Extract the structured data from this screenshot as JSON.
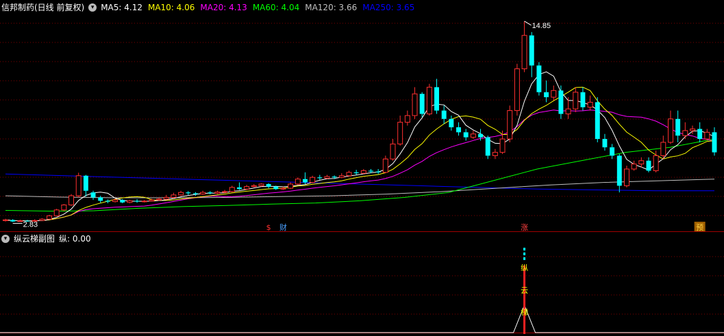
{
  "main_header": {
    "title": "信邦制药(日线 前复权)",
    "ma": [
      {
        "label": "MA5: 4.12",
        "color": "#ffffff"
      },
      {
        "label": "MA10: 4.06",
        "color": "#ffff00"
      },
      {
        "label": "MA20: 4.13",
        "color": "#ff00ff"
      },
      {
        "label": "MA60: 4.04",
        "color": "#00ff00"
      },
      {
        "label": "MA120: 3.66",
        "color": "#c0c0c0"
      },
      {
        "label": "MA250: 3.65",
        "color": "#0000ff"
      }
    ]
  },
  "sub_header": {
    "title": "纵云梯副图",
    "value_label": "纵: 0.00"
  },
  "annotations": {
    "low": "2.83",
    "high": "14.85",
    "markers": [
      {
        "text": "$",
        "color": "#ff3030"
      },
      {
        "text": "财",
        "color": "#4aa0ff"
      },
      {
        "text": "涨",
        "color": "#ff4040"
      },
      {
        "text": "预",
        "color": "#ffd040"
      }
    ],
    "sub_chars": [
      "纵",
      "云",
      "梯"
    ]
  },
  "colors": {
    "up": "#ff3030",
    "down": "#00ffff",
    "grid": "#800000",
    "ma5": "#ffffff",
    "ma10": "#ffff00",
    "ma20": "#ff00ff",
    "ma60": "#00ff00",
    "ma120": "#c0c0c0",
    "ma250": "#0000ff"
  },
  "chart_data": {
    "type": "candlestick",
    "y_range_approx": [
      2.6,
      15.3
    ],
    "candles": [
      [
        2.91,
        2.96,
        3.02,
        2.86
      ],
      [
        2.95,
        2.86,
        3.0,
        2.83
      ],
      [
        2.86,
        2.9,
        2.97,
        2.85
      ],
      [
        2.9,
        2.88,
        2.96,
        2.85
      ],
      [
        2.88,
        2.92,
        2.99,
        2.86
      ],
      [
        2.92,
        3.0,
        3.06,
        2.9
      ],
      [
        3.0,
        3.2,
        3.26,
        2.98
      ],
      [
        3.2,
        3.55,
        3.62,
        3.18
      ],
      [
        3.55,
        3.85,
        3.9,
        3.5
      ],
      [
        3.85,
        4.4,
        4.5,
        3.8
      ],
      [
        4.4,
        5.6,
        5.78,
        4.3
      ],
      [
        5.6,
        4.7,
        5.65,
        4.35
      ],
      [
        4.6,
        4.3,
        4.7,
        4.15
      ],
      [
        4.3,
        4.1,
        4.4,
        3.98
      ],
      [
        4.1,
        4.05,
        4.18,
        3.95
      ],
      [
        4.05,
        4.15,
        4.23,
        4.0
      ],
      [
        4.15,
        4.0,
        4.2,
        3.95
      ],
      [
        4.0,
        4.1,
        4.16,
        3.95
      ],
      [
        4.1,
        4.05,
        4.2,
        3.98
      ],
      [
        4.05,
        4.08,
        4.15,
        4.0
      ],
      [
        4.08,
        4.15,
        4.22,
        4.05
      ],
      [
        4.15,
        4.2,
        4.28,
        4.1
      ],
      [
        4.2,
        4.3,
        4.45,
        4.15
      ],
      [
        4.3,
        4.45,
        4.58,
        4.25
      ],
      [
        4.45,
        4.6,
        4.7,
        4.4
      ],
      [
        4.6,
        4.55,
        4.68,
        4.45
      ],
      [
        4.55,
        4.5,
        4.62,
        4.4
      ],
      [
        4.5,
        4.6,
        4.7,
        4.45
      ],
      [
        4.6,
        4.55,
        4.68,
        4.48
      ],
      [
        4.55,
        4.62,
        4.7,
        4.5
      ],
      [
        4.62,
        4.65,
        4.75,
        4.55
      ],
      [
        4.65,
        4.9,
        5.0,
        4.6
      ],
      [
        4.9,
        4.8,
        5.2,
        4.75
      ],
      [
        4.8,
        4.95,
        5.05,
        4.75
      ],
      [
        4.95,
        5.0,
        5.1,
        4.9
      ],
      [
        5.0,
        5.1,
        5.15,
        4.95
      ],
      [
        5.1,
        4.95,
        5.15,
        4.85
      ],
      [
        4.95,
        4.8,
        5.0,
        4.75
      ],
      [
        4.8,
        4.85,
        4.95,
        4.75
      ],
      [
        4.85,
        5.1,
        5.2,
        4.8
      ],
      [
        5.1,
        5.4,
        5.5,
        5.05
      ],
      [
        5.4,
        5.2,
        5.8,
        5.1
      ],
      [
        5.2,
        5.5,
        5.6,
        5.15
      ],
      [
        5.5,
        5.45,
        5.65,
        5.35
      ],
      [
        5.45,
        5.55,
        5.65,
        5.4
      ],
      [
        5.55,
        5.5,
        5.62,
        5.4
      ],
      [
        5.5,
        5.6,
        5.75,
        5.45
      ],
      [
        5.6,
        5.8,
        5.9,
        5.55
      ],
      [
        5.8,
        5.75,
        5.95,
        5.65
      ],
      [
        5.75,
        5.9,
        6.0,
        5.7
      ],
      [
        5.9,
        5.85,
        6.0,
        5.75
      ],
      [
        5.85,
        5.8,
        6.0,
        5.7
      ],
      [
        5.8,
        6.6,
        6.8,
        5.75
      ],
      [
        6.6,
        7.5,
        7.8,
        6.5
      ],
      [
        7.5,
        8.8,
        9.2,
        7.4
      ],
      [
        8.8,
        9.2,
        9.5,
        8.6
      ],
      [
        9.2,
        10.5,
        10.9,
        9.0
      ],
      [
        10.5,
        9.3,
        10.6,
        9.1
      ],
      [
        9.3,
        10.9,
        11.1,
        9.2
      ],
      [
        10.9,
        9.5,
        11.4,
        9.3
      ],
      [
        9.5,
        9.0,
        9.8,
        8.7
      ],
      [
        9.0,
        8.5,
        9.2,
        8.3
      ],
      [
        8.5,
        8.2,
        8.8,
        8.0
      ],
      [
        8.2,
        7.9,
        8.4,
        7.7
      ],
      [
        7.9,
        8.1,
        8.3,
        7.8
      ],
      [
        8.1,
        7.9,
        8.4,
        7.7
      ],
      [
        7.9,
        6.8,
        8.0,
        6.6
      ],
      [
        6.8,
        7.0,
        7.2,
        6.6
      ],
      [
        7.0,
        7.8,
        8.3,
        6.9
      ],
      [
        7.8,
        9.5,
        9.8,
        7.6
      ],
      [
        9.5,
        12.0,
        12.3,
        9.2
      ],
      [
        12.0,
        14.0,
        14.85,
        11.8
      ],
      [
        14.0,
        12.2,
        14.2,
        11.5
      ],
      [
        12.2,
        10.6,
        12.4,
        10.4
      ],
      [
        10.6,
        10.3,
        11.3,
        10.0
      ],
      [
        10.3,
        10.7,
        11.0,
        10.1
      ],
      [
        10.7,
        9.3,
        11.0,
        9.0
      ],
      [
        9.3,
        9.6,
        10.3,
        9.0
      ],
      [
        9.6,
        10.6,
        10.9,
        9.4
      ],
      [
        10.6,
        9.7,
        10.9,
        9.5
      ],
      [
        9.7,
        10.0,
        10.4,
        9.5
      ],
      [
        10.0,
        7.8,
        10.3,
        7.6
      ],
      [
        7.8,
        7.3,
        8.1,
        7.1
      ],
      [
        7.3,
        6.8,
        7.5,
        6.6
      ],
      [
        6.8,
        5.0,
        6.9,
        4.6
      ],
      [
        5.0,
        6.0,
        6.2,
        4.9
      ],
      [
        6.0,
        6.3,
        6.5,
        5.9
      ],
      [
        6.3,
        6.5,
        6.7,
        6.1
      ],
      [
        6.5,
        5.9,
        6.7,
        5.8
      ],
      [
        5.9,
        6.8,
        7.1,
        5.8
      ],
      [
        6.8,
        7.6,
        8.0,
        6.6
      ],
      [
        7.6,
        9.0,
        9.5,
        7.5
      ],
      [
        9.0,
        8.0,
        9.5,
        7.6
      ],
      [
        8.0,
        8.3,
        8.8,
        7.8
      ],
      [
        8.3,
        8.4,
        8.6,
        8.1
      ],
      [
        8.4,
        7.8,
        8.8,
        7.6
      ],
      [
        7.8,
        8.2,
        8.4,
        7.7
      ],
      [
        8.2,
        7.0,
        8.5,
        6.8
      ]
    ],
    "sub_series": {
      "name": "纵",
      "current": 0.0
    }
  }
}
